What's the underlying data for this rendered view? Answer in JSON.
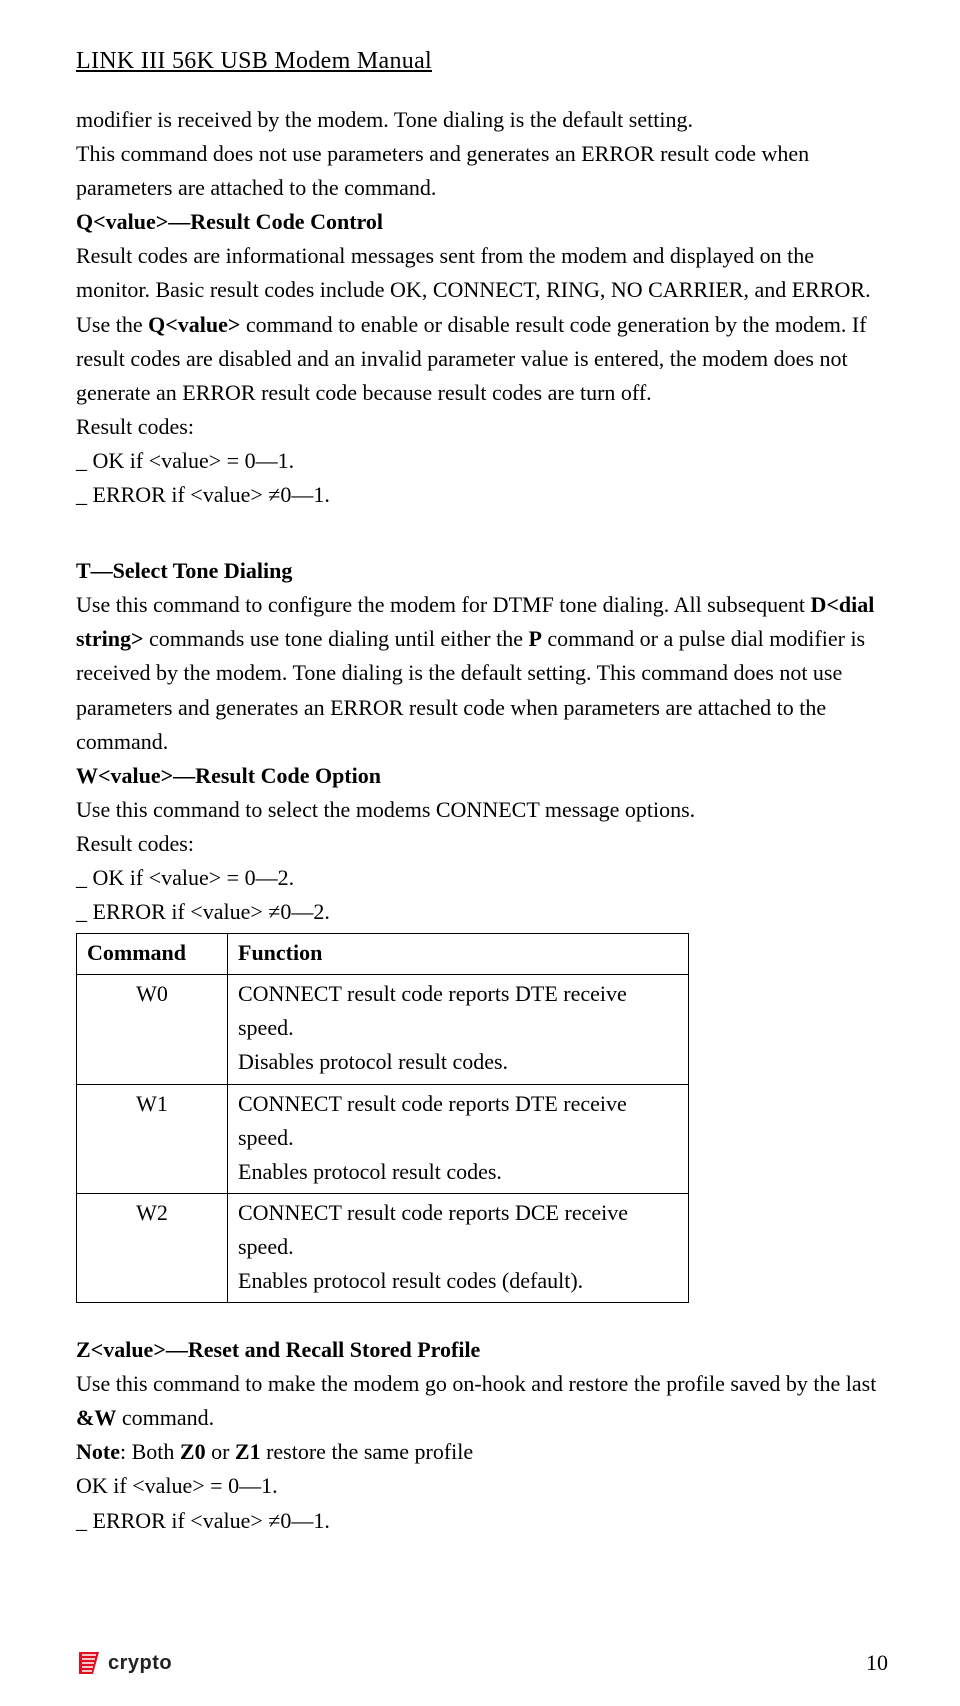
{
  "header": "LINK III 56K USB Modem Manual",
  "para1": {
    "l1": "modifier is received by the modem. Tone dialing is the default setting.",
    "l2": "This command does not use parameters and generates an ERROR result code when parameters are attached to the command."
  },
  "q": {
    "heading": "Q<value>—Result Code Control",
    "body_a": "Result codes are informational messages sent from the modem and displayed on the monitor. Basic result codes include OK, CONNECT, RING, NO CARRIER, and ERROR. Use the ",
    "body_b": "Q<value>",
    "body_c": " command to enable or disable result code generation by the modem. If result codes are disabled and an invalid parameter value is entered, the modem does not generate an ERROR result code because result codes are turn off.",
    "rc_label": "Result codes:",
    "rc_ok": "_ OK if <value> = 0—1.",
    "rc_err": "_ ERROR if <value> ≠0—1."
  },
  "t": {
    "heading": "T—Select Tone Dialing",
    "body_a": "Use this command to configure the modem for DTMF tone dialing. All subsequent ",
    "body_b": "D<dial string>",
    "body_c": " commands use tone dialing until either the ",
    "body_d": "P",
    "body_e": " command or a pulse dial modifier is received by the modem. Tone dialing is the default setting. This command does not use parameters and generates an ERROR result code when parameters are attached to the command."
  },
  "w": {
    "heading": "W<value>—Result Code Option",
    "body": "Use this command to select the modems CONNECT message options.",
    "rc_label": "Result codes:",
    "rc_ok": "_ OK if <value> = 0—2.",
    "rc_err": "_ ERROR if <value> ≠0—2.",
    "table": {
      "head_cmd": "Command",
      "head_fn": "Function",
      "rows": [
        {
          "cmd": "W0",
          "fn_l1": "CONNECT result code reports DTE receive speed.",
          "fn_l2": "Disables protocol result codes."
        },
        {
          "cmd": "W1",
          "fn_l1": "CONNECT result code reports DTE receive speed.",
          "fn_l2": "Enables protocol result codes."
        },
        {
          "cmd": "W2",
          "fn_l1": "CONNECT result code reports DCE receive speed.",
          "fn_l2": "Enables protocol result codes (default)."
        }
      ]
    }
  },
  "z": {
    "heading": "Z<value>—Reset and Recall Stored Profile",
    "body_a": "Use this command to make the modem go on-hook and restore the profile saved by the last ",
    "body_b": "&W",
    "body_c": " command.",
    "note_a": "Note",
    "note_b": ": Both ",
    "note_c": "Z0",
    "note_d": " or ",
    "note_e": "Z1",
    "note_f": " restore the same profile",
    "ok": "OK if <value> = 0—1.",
    "err": "_ ERROR if <value> ≠0—1."
  },
  "footer": {
    "brand": "crypto",
    "page": "10"
  }
}
